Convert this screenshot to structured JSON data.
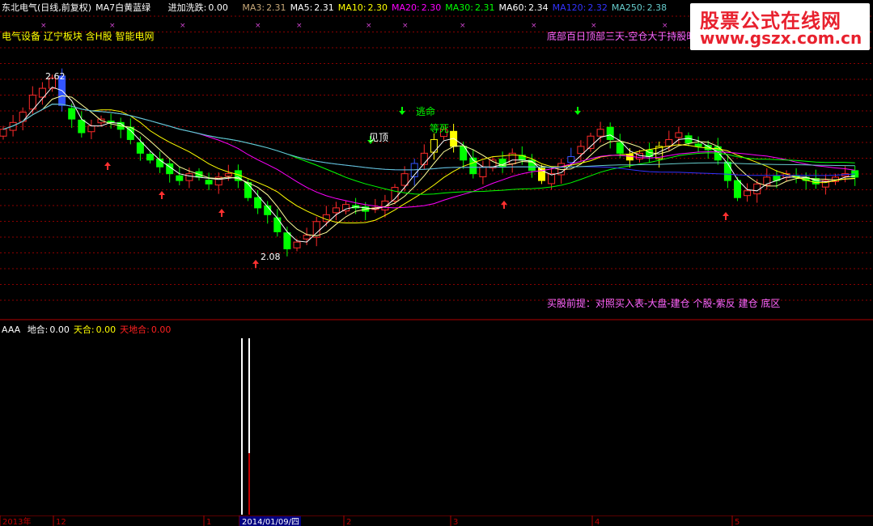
{
  "header": {
    "title": "东北电气(日线,前复权)",
    "indicator_name": "MA7白黄蓝绿",
    "jjxd": {
      "label": "进加洗跌:",
      "value": "0.00"
    },
    "mas": [
      {
        "label": "MA3:",
        "value": "2.31",
        "color": "#c8a878"
      },
      {
        "label": "MA5:",
        "value": "2.31",
        "color": "#ffffff"
      },
      {
        "label": "MA10:",
        "value": "2.30",
        "color": "#ffff00"
      },
      {
        "label": "MA20:",
        "value": "2.30",
        "color": "#ff00ff"
      },
      {
        "label": "MA30:",
        "value": "2.31",
        "color": "#00ff00"
      },
      {
        "label": "MA60:",
        "value": "2.34",
        "color": "#ffffff"
      },
      {
        "label": "MA120:",
        "value": "2.32",
        "color": "#3333ff"
      },
      {
        "label": "MA250:",
        "value": "2.38",
        "color": "#66cccc"
      }
    ]
  },
  "sectors": "电气设备 辽宁板块 含H股 智能电网",
  "top_right_note": "底部百日顶部三天-空仓大于持股时",
  "buy_premise": "买股前提：对照买入表-大盘-建仓   个股-紫反 建仓 底区",
  "annotations": {
    "high_label": "2.62",
    "low_label": "2.08",
    "jianding": "见顶",
    "taoming": "逃命",
    "dengsi": "等死"
  },
  "sub_panel": {
    "name": "AAA",
    "items": [
      {
        "label": "地合:",
        "value": "0.00",
        "color": "#ffffff"
      },
      {
        "label": "天合:",
        "value": "0.00",
        "color": "#ffff00"
      },
      {
        "label": "天地合:",
        "value": "0.00",
        "color": "#ff2020"
      }
    ]
  },
  "x_axis": {
    "labels": [
      "2013年",
      "12",
      "1",
      "2014/01/09/四",
      "2",
      "3",
      "4",
      "5"
    ]
  },
  "watermark": {
    "line1": "股票公式在线网",
    "line2": "www.gszx.com.cn"
  },
  "colors": {
    "up": "#ff2a2a",
    "down": "#00ff00",
    "special_down": "#3355ff",
    "special_up": "#ffff00",
    "grid": "#8b0000",
    "panel_border": "#b00000"
  },
  "chart_data": {
    "type": "candlestick",
    "title": "东北电气(日线,前复权)",
    "y_range": [
      2.0,
      2.65
    ],
    "high": 2.62,
    "low": 2.08,
    "x_labels": [
      "2013年",
      "12",
      "1",
      "2014/01/09/四",
      "2",
      "3",
      "4",
      "5"
    ],
    "close_series": [
      2.45,
      2.47,
      2.5,
      2.55,
      2.57,
      2.6,
      2.52,
      2.48,
      2.44,
      2.46,
      2.48,
      2.47,
      2.45,
      2.42,
      2.38,
      2.36,
      2.34,
      2.32,
      2.3,
      2.32,
      2.31,
      2.29,
      2.31,
      2.32,
      2.3,
      2.25,
      2.22,
      2.2,
      2.15,
      2.1,
      2.12,
      2.14,
      2.18,
      2.2,
      2.22,
      2.23,
      2.22,
      2.21,
      2.22,
      2.24,
      2.28,
      2.32,
      2.35,
      2.38,
      2.42,
      2.45,
      2.4,
      2.36,
      2.32,
      2.34,
      2.36,
      2.34,
      2.38,
      2.36,
      2.33,
      2.3,
      2.32,
      2.35,
      2.37,
      2.4,
      2.43,
      2.45,
      2.42,
      2.38,
      2.36,
      2.38,
      2.37,
      2.4,
      2.42,
      2.44,
      2.41,
      2.4,
      2.39,
      2.36,
      2.3,
      2.25,
      2.27,
      2.29,
      2.31,
      2.3,
      2.32,
      2.31,
      2.3,
      2.29,
      2.3,
      2.31,
      2.32,
      2.31
    ]
  }
}
